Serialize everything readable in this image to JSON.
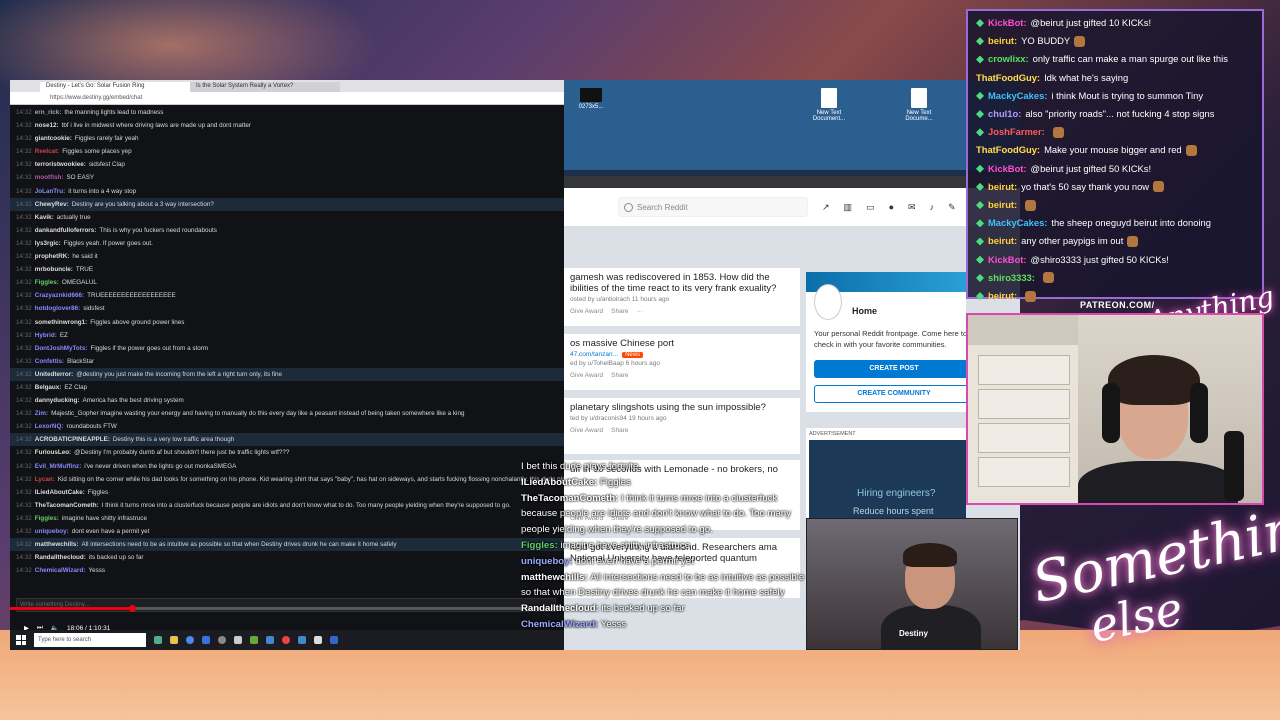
{
  "browser": {
    "tabs": [
      "Destiny - Let's Go: Solar Fusion Ring",
      "Is the Solar System Really a Vortex?"
    ],
    "url": "https://www.destiny.gg/embed/chat"
  },
  "left_chat": {
    "messages": [
      {
        "time": "14:32",
        "user": "ern_rick",
        "text": "the manning lights lead to madness",
        "color": "#9aa"
      },
      {
        "time": "14:32",
        "user": "nose12",
        "text": "tbf i live in midwest where driving laws are made up and dont matter",
        "color": "#ddd"
      },
      {
        "time": "14:32",
        "user": "giantcookie",
        "text": "Figgles rarely fair yeah",
        "color": "#ddd"
      },
      {
        "time": "14:32",
        "user": "Reelcat",
        "text": "Figgles some places yep",
        "color": "#c44"
      },
      {
        "time": "14:32",
        "user": "terroristwookiee",
        "text": "sidsfest Clap",
        "color": "#ddd"
      },
      {
        "time": "14:32",
        "user": "mootfish",
        "text": "SO EASY",
        "color": "#b5a"
      },
      {
        "time": "14:32",
        "user": "JoLanTru",
        "text": "it turns into a 4 way stop",
        "color": "#88f"
      },
      {
        "time": "14:32",
        "user": "ChewyRev",
        "text": "Destiny are you talking about a 3 way intersection?",
        "color": "#ddd",
        "hl": true
      },
      {
        "time": "14:32",
        "user": "Kavik",
        "text": "actually true",
        "color": "#ddd"
      },
      {
        "time": "14:32",
        "user": "dankandfulloferrors",
        "text": "This is why you fuckers need roundabouts",
        "color": "#ddd"
      },
      {
        "time": "14:32",
        "user": "lys3rgic",
        "text": "Figgles yeah. If power goes out.",
        "color": "#ddd"
      },
      {
        "time": "14:32",
        "user": "prophetRK",
        "text": "he said it",
        "color": "#ddd"
      },
      {
        "time": "14:32",
        "user": "mrbobuncle",
        "text": "TRUE",
        "color": "#ddd"
      },
      {
        "time": "14:32",
        "user": "Figgles",
        "text": "OMEGALUL",
        "color": "#6c6"
      },
      {
        "time": "14:32",
        "user": "Crazyaznkid666",
        "text": "TRUEEEEEEEEEEEEEEEEEE",
        "color": "#88f"
      },
      {
        "time": "14:32",
        "user": "hotdoglover86",
        "text": "sidsfest",
        "color": "#88f"
      },
      {
        "time": "14:32",
        "user": "somethinwrong1",
        "text": "Figgles above ground power lines",
        "color": "#ddd"
      },
      {
        "time": "14:32",
        "user": "Hybrid",
        "text": "EZ",
        "color": "#88f"
      },
      {
        "time": "14:32",
        "user": "DontJoshMyTots",
        "text": "Figgles if the power goes out from a storm",
        "color": "#88f"
      },
      {
        "time": "14:32",
        "user": "Confettis",
        "text": "BlackStar",
        "color": "#88f"
      },
      {
        "time": "14:32",
        "user": "Unitedterror",
        "text": "@destiny you just make the incoming from the left a right turn only, its fine",
        "color": "#ddd",
        "hl": true
      },
      {
        "time": "14:32",
        "user": "Belgaux",
        "text": "EZ Clap",
        "color": "#ddd"
      },
      {
        "time": "14:32",
        "user": "dannyducking",
        "text": "America has the best driving system",
        "color": "#ddd"
      },
      {
        "time": "14:32",
        "user": "Zim",
        "text": "Majestic_Gopher imagine wasting your energy and having to manually do this every day like a peasant instead of being taken somewhere like a king",
        "color": "#88f"
      },
      {
        "time": "14:32",
        "user": "LexorNQ",
        "text": "roundabouts FTW",
        "color": "#88f"
      },
      {
        "time": "14:32",
        "user": "ACROBATICPINEAPPLE",
        "text": "Destiny this is a very low traffic area though",
        "color": "#ddd",
        "hl": true
      },
      {
        "time": "14:32",
        "user": "FuriousLeo",
        "text": "@Destiny I'm probably dumb af but shouldn't there just be traffic lights wtf???",
        "color": "#ddd"
      },
      {
        "time": "14:32",
        "user": "Evil_MrMuffinz",
        "text": "i've never driven when the lights go out monkaSMEGA",
        "color": "#88f"
      },
      {
        "time": "14:32",
        "user": "Lycan",
        "text": "Kid sitting on the corner while his dad looks for something on his phone. Kid wearing shirt that says \"baby\", has hat on sideways, and starts fucking flossing nonchalantly. this dude plays fortnite.",
        "color": "#c44"
      },
      {
        "time": "14:32",
        "user": "ILiedAboutCake",
        "text": "Figgles",
        "color": "#ddd"
      },
      {
        "time": "14:32",
        "user": "TheTacomanCometh",
        "text": "I think it turns mroe into a clusterfuck because people are idiots and don't know what to do. Too many people yielding when they're supposed to go.",
        "color": "#ddd"
      },
      {
        "time": "14:32",
        "user": "Figgles",
        "text": "imagine have shitty infrastruce",
        "color": "#6c6"
      },
      {
        "time": "14:32",
        "user": "uniqueboy",
        "text": "dont even have a permit yet",
        "color": "#88f"
      },
      {
        "time": "14:32",
        "user": "matthewchills",
        "text": "All intersections need to be as intuitive as possible so that when Destiny drives drunk he can make it home safely",
        "color": "#ddd",
        "hl": true
      },
      {
        "time": "14:32",
        "user": "Randallthecloud",
        "text": "its backed up so far",
        "color": "#ddd"
      },
      {
        "time": "14:32",
        "user": "ChemicalWizard",
        "text": "Yesss",
        "color": "#88f"
      }
    ],
    "input_placeholder": "Write something Destiny..."
  },
  "player": {
    "progress": 0.22,
    "time": "18:06 / 1:10:31"
  },
  "taskbar": {
    "search_placeholder": "Type here to search"
  },
  "desktop": {
    "icons": [
      "New Text Document...",
      "New Text Docume..."
    ],
    "small_label": "0273x5..."
  },
  "reddit": {
    "search_placeholder": "Search Reddit",
    "posts": [
      {
        "title": "gamesh was rediscovered in 1853. How did the ibilities of the time react to its very frank exuality?",
        "meta": "osted by u/antiolrach 11 hours ago",
        "give": "Give Award",
        "share": "Share"
      },
      {
        "title": "os massive Chinese port",
        "sub": "47.com/tanzan...",
        "badge": "News",
        "meta": "ed by u/TohelBaap 6 hours ago",
        "give": "Give Award",
        "share": "Share"
      },
      {
        "title": "planetary slingshots using the sun impossible?",
        "meta": "ted by u/draconis94 19 hours ago",
        "give": "Give Award",
        "share": "Share"
      },
      {
        "title": "uff in 90 seconds with Lemonade - no brokers, no",
        "meta": "",
        "give": "Give Award",
        "share": "Share"
      },
      {
        "title": "kind got everything a diamond. Researchers ama National University have teleported quantum",
        "meta": "",
        "give": "",
        "share": ""
      }
    ],
    "home": {
      "title": "Home",
      "desc": "Your personal Reddit frontpage. Come here to check in with your favorite communities.",
      "create_post": "CREATE POST",
      "create_community": "CREATE COMMUNITY"
    },
    "ad": {
      "label": "ADVERTISEMENT",
      "headline": "Hiring engineers?",
      "sub": "Reduce hours spent"
    }
  },
  "overlay_chat": [
    {
      "user": "",
      "text": "I bet this dude plays fortnite."
    },
    {
      "user": "ILiedAboutCake:",
      "text": "Figgles"
    },
    {
      "user": "TheTacomanCometh:",
      "text": "I think it turns mroe into a clusterfuck because people are idiots and don't know what to do. Too many people yielding when they're supposed to go."
    },
    {
      "user": "Figgles:",
      "text": "imagine have shitty infrastruce"
    },
    {
      "user": "uniqueboy:",
      "text": "dont even have a permit yet"
    },
    {
      "user": "matthewchills:",
      "text": "All intersections need to be as intuitive as possible so that when Destiny drives drunk he can make it home safely"
    },
    {
      "user": "Randallthecloud:",
      "text": "its backed up so far"
    },
    {
      "user": "ChemicalWizard:",
      "text": "Yesss"
    }
  ],
  "inner_cam": {
    "label": "Destiny"
  },
  "right_chat": [
    {
      "user": "KickBot:",
      "text": "@beirut just gifted 10 KICKs!",
      "color": "#ff4fd0",
      "badges": true
    },
    {
      "user": "beirut:",
      "text": "YO BUDDY",
      "color": "#ffcf3a",
      "badges": true
    },
    {
      "user": "crowlixx:",
      "text": "only traffic can make a man spurge out like this",
      "color": "#5be15b",
      "badges": true
    },
    {
      "user": "ThatFoodGuy:",
      "text": "Idk what he's saying",
      "color": "#ffe14d",
      "badges": false
    },
    {
      "user": "MackyCakes:",
      "text": "i think Mout is trying to summon Tiny",
      "color": "#3ec3ff",
      "badges": true
    },
    {
      "user": "chul1o:",
      "text": "also \"priority roads\"... not fucking 4 stop signs",
      "color": "#b49bff",
      "badges": true
    },
    {
      "user": "JoshFarmer:",
      "text": "",
      "color": "#ff5a5a",
      "badges": true
    },
    {
      "user": "ThatFoodGuy:",
      "text": "Make your mouse bigger and red",
      "color": "#ffe14d",
      "badges": false
    },
    {
      "user": "KickBot:",
      "text": "@beirut just gifted 50 KICKs!",
      "color": "#ff4fd0",
      "badges": true
    },
    {
      "user": "beirut:",
      "text": "yo that's 50 say thank you now",
      "color": "#ffcf3a",
      "badges": true
    },
    {
      "user": "beirut:",
      "text": "",
      "color": "#ffcf3a",
      "badges": true
    },
    {
      "user": "MackyCakes:",
      "text": "the sheep oneguyd beirut into donoing",
      "color": "#3ec3ff",
      "badges": true
    },
    {
      "user": "beirut:",
      "text": "any other paypigs im out",
      "color": "#ffcf3a",
      "badges": true
    },
    {
      "user": "KickBot:",
      "text": "@shiro3333 just gifted 50 KICKs!",
      "color": "#ff4fd0",
      "badges": true
    },
    {
      "user": "shiro3333:",
      "text": "",
      "color": "#5be15b",
      "badges": true
    },
    {
      "user": "beirut:",
      "text": "",
      "color": "#ffcf3a",
      "badges": true
    }
  ],
  "branding": {
    "patreon": "PATREON.COM/",
    "logo_small": "Anything else",
    "logo_line1": "Something",
    "logo_line2": "else"
  }
}
